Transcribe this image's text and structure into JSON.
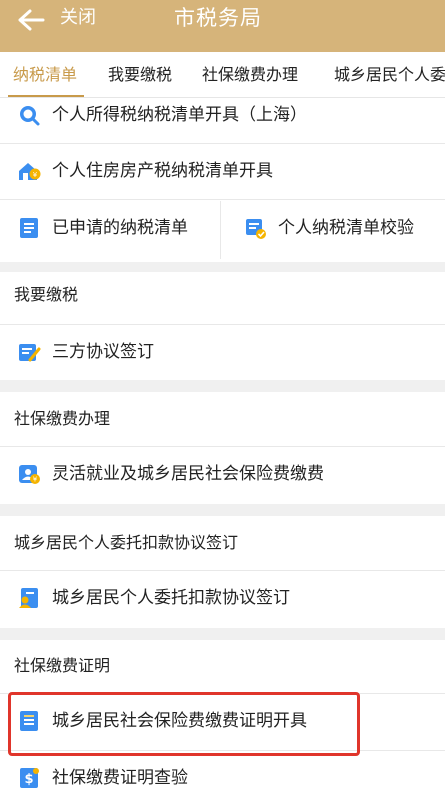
{
  "header": {
    "close_label": "关闭",
    "title": "市税务局"
  },
  "tabs": [
    {
      "label": "纳税清单",
      "active": true
    },
    {
      "label": "我要缴税",
      "active": false
    },
    {
      "label": "社保缴费办理",
      "active": false
    },
    {
      "label": "城乡居民个人委",
      "active": false
    }
  ],
  "tax_list_section": {
    "items": [
      {
        "label": "个人所得税纳税清单开具（上海）",
        "icon": "magnifier-icon"
      },
      {
        "label": "个人住房房产税纳税清单开具",
        "icon": "house-tax-icon"
      },
      {
        "label": "已申请的纳税清单",
        "icon": "document-list-icon"
      },
      {
        "label": "个人纳税清单校验",
        "icon": "verify-document-icon"
      }
    ]
  },
  "pay_tax_section": {
    "title": "我要缴税",
    "items": [
      {
        "label": "三方协议签订",
        "icon": "agreement-sign-icon"
      }
    ]
  },
  "social_insurance_section": {
    "title": "社保缴费办理",
    "items": [
      {
        "label": "灵活就业及城乡居民社会保险费缴费",
        "icon": "insurance-pay-icon"
      }
    ]
  },
  "entrust_section": {
    "title": "城乡居民个人委托扣款协议签订",
    "items": [
      {
        "label": "城乡居民个人委托扣款协议签订",
        "icon": "person-document-icon"
      }
    ]
  },
  "certificate_section": {
    "title": "社保缴费证明",
    "items": [
      {
        "label": "城乡居民社会保险费缴费证明开具",
        "icon": "certificate-document-icon"
      },
      {
        "label": "社保缴费证明查验",
        "icon": "dollar-document-icon"
      }
    ]
  },
  "colors": {
    "header_bg": "#d6b47a",
    "accent": "#c89a4a",
    "icon_blue": "#3b8ef0",
    "highlight_red": "#e0352b"
  }
}
